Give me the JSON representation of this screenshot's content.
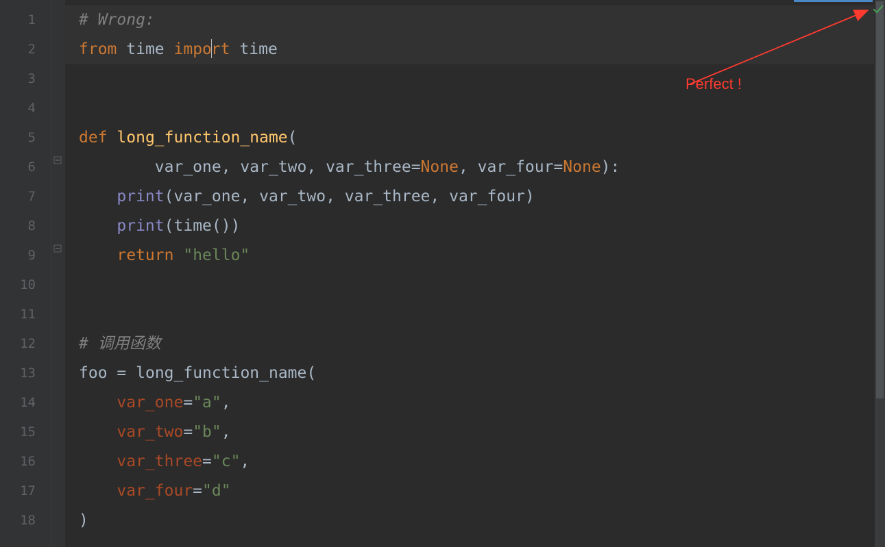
{
  "gutter": {
    "lines": [
      "1",
      "2",
      "3",
      "4",
      "5",
      "6",
      "7",
      "8",
      "9",
      "10",
      "11",
      "12",
      "13",
      "14",
      "15",
      "16",
      "17",
      "18"
    ]
  },
  "code": {
    "l1": {
      "comment": "# Wrong:"
    },
    "l2": {
      "kw_from": "from",
      "mod": "time",
      "kw_import_a": "impo",
      "kw_import_b": "rt",
      "name": "time"
    },
    "l5": {
      "kw_def": "def",
      "fname": "long_function_name",
      "open": "("
    },
    "l6": {
      "indent": "        ",
      "p1": "var_one",
      "c1": ", ",
      "p2": "var_two",
      "c2": ", ",
      "p3": "var_three",
      "eq1": "=",
      "none1": "None",
      "c3": ", ",
      "p4": "var_four",
      "eq2": "=",
      "none2": "None",
      "close": "):"
    },
    "l7": {
      "indent": "    ",
      "call": "print",
      "open": "(",
      "a1": "var_one",
      "c1": ", ",
      "a2": "var_two",
      "c2": ", ",
      "a3": "var_three",
      "c3": ", ",
      "a4": "var_four",
      "close": ")"
    },
    "l8": {
      "indent": "    ",
      "call": "print",
      "open": "(",
      "inner": "time",
      "inner_p": "()",
      "close": ")"
    },
    "l9": {
      "indent": "    ",
      "kw_return": "return",
      "sp": " ",
      "str": "\"hello\""
    },
    "l12": {
      "comment": "# 调用函数"
    },
    "l13": {
      "var": "foo",
      "sp": " ",
      "eq": "=",
      "sp2": " ",
      "fname": "long_function_name",
      "open": "("
    },
    "l14": {
      "indent": "    ",
      "kw": "var_one",
      "eq": "=",
      "str": "\"a\"",
      "comma": ","
    },
    "l15": {
      "indent": "    ",
      "kw": "var_two",
      "eq": "=",
      "str": "\"b\"",
      "comma": ","
    },
    "l16": {
      "indent": "    ",
      "kw": "var_three",
      "eq": "=",
      "str": "\"c\"",
      "comma": ","
    },
    "l17": {
      "indent": "    ",
      "kw": "var_four",
      "eq": "=",
      "str": "\"d\""
    },
    "l18": {
      "close": ")"
    }
  },
  "annotation": {
    "label": "Perfect !"
  },
  "status": {
    "check": "ok"
  }
}
